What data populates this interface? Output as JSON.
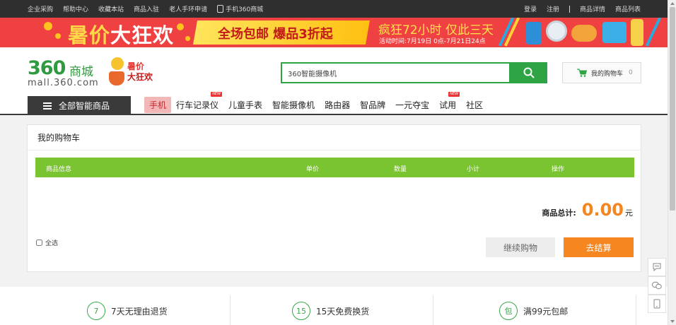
{
  "topbar": {
    "links_left": [
      "企业采购",
      "帮助中心",
      "收藏本站",
      "商品入驻",
      "老人手环申请"
    ],
    "mobile_link": "手机360商城",
    "links_right": [
      "登录",
      "注册",
      "商品详情",
      "商品列表"
    ]
  },
  "banner": {
    "headline_part1": "暑价",
    "headline_part2": "大狂欢",
    "free_shipping": "全场包邮 爆品3折起",
    "crazy_hours": "疯狂72小时 仅此三天",
    "time_text": "活动时间:7月19日 0点-7月21日24点"
  },
  "header": {
    "logo_number": "360",
    "logo_mall": "商城",
    "logo_domain": "mall.360.com",
    "promo_line1": "暑价",
    "promo_line2": "大狂欢",
    "search_value": "360智能摄像机",
    "cart_label": "我的购物车",
    "cart_count": "0"
  },
  "nav": {
    "all_categories": "全部智能商品",
    "items": [
      {
        "label": "手机",
        "active": true,
        "new": false
      },
      {
        "label": "行车记录仪",
        "active": false,
        "new": true
      },
      {
        "label": "儿童手表",
        "active": false,
        "new": false
      },
      {
        "label": "智能摄像机",
        "active": false,
        "new": false
      },
      {
        "label": "路由器",
        "active": false,
        "new": false
      },
      {
        "label": "智品牌",
        "active": false,
        "new": false
      },
      {
        "label": "一元夺宝",
        "active": false,
        "new": false
      },
      {
        "label": "试用",
        "active": false,
        "new": true
      },
      {
        "label": "社区",
        "active": false,
        "new": false
      }
    ],
    "new_badge": "NEW"
  },
  "cart": {
    "title": "我的购物车",
    "columns": [
      "商品信息",
      "单价",
      "数量",
      "小计",
      "操作"
    ],
    "total_label": "商品总计:",
    "total_amount": "0.00",
    "currency": "元",
    "select_all": "全选",
    "continue_label": "继续购物",
    "checkout_label": "去结算"
  },
  "services": [
    {
      "icon_text": "7",
      "label": "7天无理由退货"
    },
    {
      "icon_text": "15",
      "label": "15天免费换货"
    },
    {
      "icon_text": "包",
      "label": "满99元包邮"
    }
  ],
  "colors": {
    "green": "#2fa444",
    "table_header": "#7ac331",
    "checkout": "#f6861f",
    "banner": "#ef4141"
  },
  "icons": [
    "phone-icon",
    "search-icon",
    "cart-icon",
    "menu-icon",
    "feedback-icon",
    "wechat-icon",
    "mobile-icon"
  ]
}
